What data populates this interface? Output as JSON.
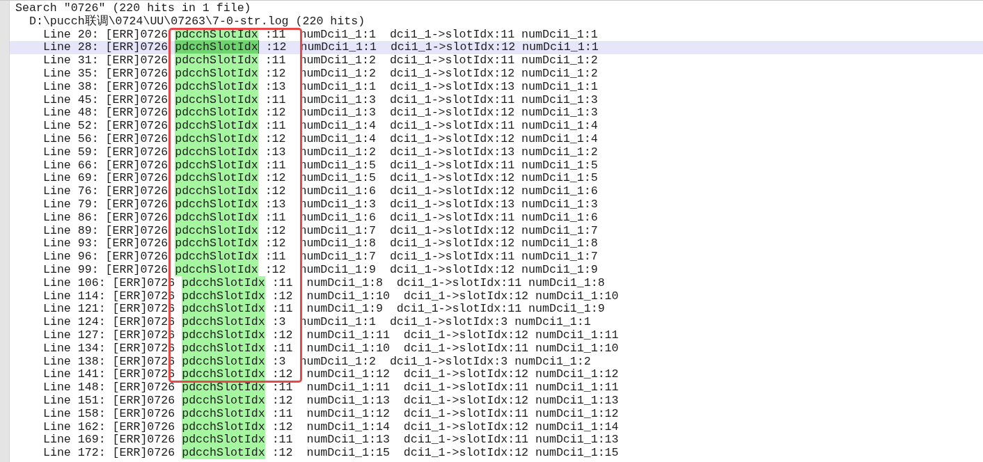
{
  "search_header": "Search \"0726\" (220 hits in 1 file)",
  "file": {
    "path": "D:\\pucch联调\\0724\\UU\\07263\\7-0-str.log (220 hits)"
  },
  "results": [
    {
      "prefix": "Line 20: [ERR]0726 ",
      "match": "pdcchSlotIdx",
      "suffix": " :11  numDci1_1:1  dci1_1->slotIdx:11 numDci1_1:1",
      "selected": false
    },
    {
      "prefix": "Line 28: [ERR]0726 ",
      "match": "pdcchSlotIdx",
      "suffix": " :12  numDci1_1:1  dci1_1->slotIdx:12 numDci1_1:1",
      "selected": true
    },
    {
      "prefix": "Line 31: [ERR]0726 ",
      "match": "pdcchSlotIdx",
      "suffix": " :11  numDci1_1:2  dci1_1->slotIdx:11 numDci1_1:2",
      "selected": false
    },
    {
      "prefix": "Line 35: [ERR]0726 ",
      "match": "pdcchSlotIdx",
      "suffix": " :12  numDci1_1:2  dci1_1->slotIdx:12 numDci1_1:2",
      "selected": false
    },
    {
      "prefix": "Line 38: [ERR]0726 ",
      "match": "pdcchSlotIdx",
      "suffix": " :13  numDci1_1:1  dci1_1->slotIdx:13 numDci1_1:1",
      "selected": false
    },
    {
      "prefix": "Line 45: [ERR]0726 ",
      "match": "pdcchSlotIdx",
      "suffix": " :11  numDci1_1:3  dci1_1->slotIdx:11 numDci1_1:3",
      "selected": false
    },
    {
      "prefix": "Line 48: [ERR]0726 ",
      "match": "pdcchSlotIdx",
      "suffix": " :12  numDci1_1:3  dci1_1->slotIdx:12 numDci1_1:3",
      "selected": false
    },
    {
      "prefix": "Line 52: [ERR]0726 ",
      "match": "pdcchSlotIdx",
      "suffix": " :11  numDci1_1:4  dci1_1->slotIdx:11 numDci1_1:4",
      "selected": false
    },
    {
      "prefix": "Line 56: [ERR]0726 ",
      "match": "pdcchSlotIdx",
      "suffix": " :12  numDci1_1:4  dci1_1->slotIdx:12 numDci1_1:4",
      "selected": false
    },
    {
      "prefix": "Line 59: [ERR]0726 ",
      "match": "pdcchSlotIdx",
      "suffix": " :13  numDci1_1:2  dci1_1->slotIdx:13 numDci1_1:2",
      "selected": false
    },
    {
      "prefix": "Line 66: [ERR]0726 ",
      "match": "pdcchSlotIdx",
      "suffix": " :11  numDci1_1:5  dci1_1->slotIdx:11 numDci1_1:5",
      "selected": false
    },
    {
      "prefix": "Line 69: [ERR]0726 ",
      "match": "pdcchSlotIdx",
      "suffix": " :12  numDci1_1:5  dci1_1->slotIdx:12 numDci1_1:5",
      "selected": false
    },
    {
      "prefix": "Line 76: [ERR]0726 ",
      "match": "pdcchSlotIdx",
      "suffix": " :12  numDci1_1:6  dci1_1->slotIdx:12 numDci1_1:6",
      "selected": false
    },
    {
      "prefix": "Line 79: [ERR]0726 ",
      "match": "pdcchSlotIdx",
      "suffix": " :13  numDci1_1:3  dci1_1->slotIdx:13 numDci1_1:3",
      "selected": false
    },
    {
      "prefix": "Line 86: [ERR]0726 ",
      "match": "pdcchSlotIdx",
      "suffix": " :11  numDci1_1:6  dci1_1->slotIdx:11 numDci1_1:6",
      "selected": false
    },
    {
      "prefix": "Line 89: [ERR]0726 ",
      "match": "pdcchSlotIdx",
      "suffix": " :12  numDci1_1:7  dci1_1->slotIdx:12 numDci1_1:7",
      "selected": false
    },
    {
      "prefix": "Line 93: [ERR]0726 ",
      "match": "pdcchSlotIdx",
      "suffix": " :12  numDci1_1:8  dci1_1->slotIdx:12 numDci1_1:8",
      "selected": false
    },
    {
      "prefix": "Line 96: [ERR]0726 ",
      "match": "pdcchSlotIdx",
      "suffix": " :11  numDci1_1:7  dci1_1->slotIdx:11 numDci1_1:7",
      "selected": false
    },
    {
      "prefix": "Line 99: [ERR]0726 ",
      "match": "pdcchSlotIdx",
      "suffix": " :12  numDci1_1:9  dci1_1->slotIdx:12 numDci1_1:9",
      "selected": false
    },
    {
      "prefix": "Line 106: [ERR]0726 ",
      "match": "pdcchSlotIdx",
      "suffix": " :11  numDci1_1:8  dci1_1->slotIdx:11 numDci1_1:8",
      "selected": false
    },
    {
      "prefix": "Line 114: [ERR]0726 ",
      "match": "pdcchSlotIdx",
      "suffix": " :12  numDci1_1:10  dci1_1->slotIdx:12 numDci1_1:10",
      "selected": false
    },
    {
      "prefix": "Line 121: [ERR]0726 ",
      "match": "pdcchSlotIdx",
      "suffix": " :11  numDci1_1:9  dci1_1->slotIdx:11 numDci1_1:9",
      "selected": false
    },
    {
      "prefix": "Line 124: [ERR]0726 ",
      "match": "pdcchSlotIdx",
      "suffix": " :3  numDci1_1:1  dci1_1->slotIdx:3 numDci1_1:1",
      "selected": false
    },
    {
      "prefix": "Line 127: [ERR]0726 ",
      "match": "pdcchSlotIdx",
      "suffix": " :12  numDci1_1:11  dci1_1->slotIdx:12 numDci1_1:11",
      "selected": false
    },
    {
      "prefix": "Line 134: [ERR]0726 ",
      "match": "pdcchSlotIdx",
      "suffix": " :11  numDci1_1:10  dci1_1->slotIdx:11 numDci1_1:10",
      "selected": false
    },
    {
      "prefix": "Line 138: [ERR]0726 ",
      "match": "pdcchSlotIdx",
      "suffix": " :3  numDci1_1:2  dci1_1->slotIdx:3 numDci1_1:2",
      "selected": false
    },
    {
      "prefix": "Line 141: [ERR]0726 ",
      "match": "pdcchSlotIdx",
      "suffix": " :12  numDci1_1:12  dci1_1->slotIdx:12 numDci1_1:12",
      "selected": false
    },
    {
      "prefix": "Line 148: [ERR]0726 ",
      "match": "pdcchSlotIdx",
      "suffix": " :11  numDci1_1:11  dci1_1->slotIdx:11 numDci1_1:11",
      "selected": false
    },
    {
      "prefix": "Line 151: [ERR]0726 ",
      "match": "pdcchSlotIdx",
      "suffix": " :12  numDci1_1:13  dci1_1->slotIdx:12 numDci1_1:13",
      "selected": false
    },
    {
      "prefix": "Line 158: [ERR]0726 ",
      "match": "pdcchSlotIdx",
      "suffix": " :11  numDci1_1:12  dci1_1->slotIdx:11 numDci1_1:12",
      "selected": false
    },
    {
      "prefix": "Line 162: [ERR]0726 ",
      "match": "pdcchSlotIdx",
      "suffix": " :12  numDci1_1:14  dci1_1->slotIdx:12 numDci1_1:14",
      "selected": false
    },
    {
      "prefix": "Line 169: [ERR]0726 ",
      "match": "pdcchSlotIdx",
      "suffix": " :11  numDci1_1:13  dci1_1->slotIdx:11 numDci1_1:13",
      "selected": false
    },
    {
      "prefix": "Line 172: [ERR]0726 ",
      "match": "pdcchSlotIdx",
      "suffix": " :12  numDci1_1:15  dci1_1->slotIdx:12 numDci1_1:15",
      "selected": false
    }
  ]
}
